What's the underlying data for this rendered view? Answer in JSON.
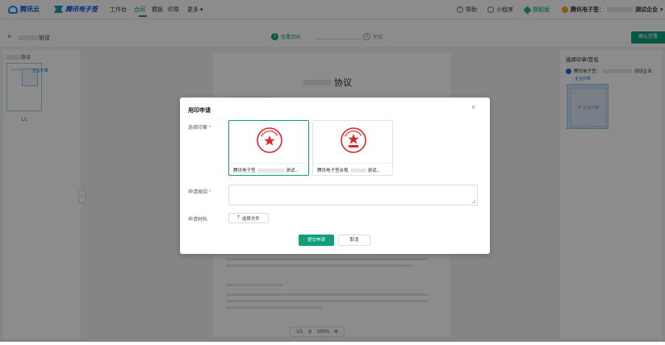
{
  "topnav": {
    "brand1": "腾讯云",
    "brand2": "腾讯电子签",
    "items": [
      "工作台",
      "合同",
      "模板",
      "印章",
      "更多"
    ],
    "more_caret": "▾",
    "help": "帮助",
    "miniprogram": "小程序",
    "vip": "旗舰版",
    "org": "腾讯电子签：",
    "org_suffix": "测试企业",
    "org_caret": "▾"
  },
  "subbar": {
    "title": "协议",
    "steps": [
      {
        "num": "1",
        "label": "签署合同"
      },
      {
        "num": "2",
        "label": "完成"
      }
    ],
    "confirm_label": "确认签署"
  },
  "leftpanel": {
    "title": "协议",
    "seal_tag": "企业印章",
    "page_num": "1/1"
  },
  "document": {
    "title_suffix": "协议"
  },
  "zoom": {
    "page": "1/1",
    "level": "100%"
  },
  "rightpanel": {
    "title": "选择印章/签名",
    "org": "腾讯电子签：",
    "org_suffix": "测试企业",
    "tag": "企业印章",
    "seal_placeholder": "企业印章"
  },
  "modal": {
    "title": "用印申请",
    "seal_label": "选择印章",
    "required_mark": "*",
    "seals": [
      {
        "name_prefix": "腾讯电子签",
        "name_suffix": "测试...",
        "selected": true
      },
      {
        "name_prefix": "腾讯电子签合规",
        "name_suffix": "测试...",
        "selected": false
      }
    ],
    "reason_label": "申请原因",
    "material_label": "申请材料",
    "upload_label": "选择文件",
    "submit_label": "提交申请",
    "cancel_label": "取消",
    "close": "×"
  },
  "colors": {
    "accent": "#0e9e7e",
    "seal_red": "#d9262c",
    "brand_blue": "#0052d9"
  }
}
